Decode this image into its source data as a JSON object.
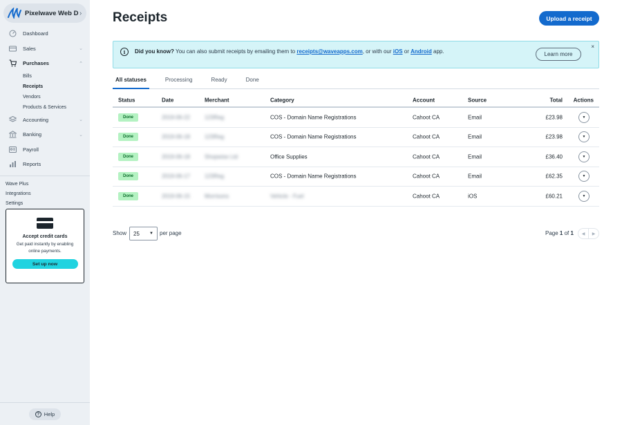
{
  "sidebar": {
    "business_name": "Pixelwave Web D...",
    "nav": [
      {
        "label": "Dashboard",
        "icon": "dashboard-icon"
      },
      {
        "label": "Sales",
        "icon": "sales-icon"
      },
      {
        "label": "Purchases",
        "icon": "cart-icon"
      }
    ],
    "purchases_sub": [
      "Bills",
      "Receipts",
      "Vendors",
      "Products & Services"
    ],
    "nav2": [
      {
        "label": "Accounting",
        "icon": "accounting-icon"
      },
      {
        "label": "Banking",
        "icon": "bank-icon"
      },
      {
        "label": "Payroll",
        "icon": "payroll-icon"
      },
      {
        "label": "Reports",
        "icon": "reports-icon"
      }
    ],
    "extras": [
      "Wave Plus",
      "Integrations",
      "Settings"
    ],
    "promo": {
      "title": "Accept credit cards",
      "text": "Get paid instantly by enabling online payments.",
      "button": "Set up now"
    },
    "help": "Help"
  },
  "page": {
    "title": "Receipts",
    "upload_button": "Upload a receipt"
  },
  "banner": {
    "strong": "Did you know?",
    "text1": " You can also submit receipts by emailing them to ",
    "email": "receipts@waveapps.com",
    "text2": ", or with our ",
    "ios": "iOS",
    "text3": " or ",
    "android": "Android",
    "text4": " app.",
    "learn_more": "Learn more",
    "close": "×"
  },
  "tabs": [
    "All statuses",
    "Processing",
    "Ready",
    "Done"
  ],
  "table": {
    "headers": {
      "status": "Status",
      "date": "Date",
      "merchant": "Merchant",
      "category": "Category",
      "account": "Account",
      "source": "Source",
      "total": "Total",
      "actions": "Actions"
    },
    "rows": [
      {
        "status": "Done",
        "date": "2019-06-22",
        "merchant": "123Reg",
        "category": "COS - Domain Name Registrations",
        "account": "Cahoot CA",
        "source": "Email",
        "total": "£23.98"
      },
      {
        "status": "Done",
        "date": "2019-06-18",
        "merchant": "123Reg",
        "category": "COS - Domain Name Registrations",
        "account": "Cahoot CA",
        "source": "Email",
        "total": "£23.98"
      },
      {
        "status": "Done",
        "date": "2019-06-18",
        "merchant": "Shopwise Ltd",
        "category": "Office Supplies",
        "account": "Cahoot CA",
        "source": "Email",
        "total": "£36.40"
      },
      {
        "status": "Done",
        "date": "2019-06-17",
        "merchant": "123Reg",
        "category": "COS - Domain Name Registrations",
        "account": "Cahoot CA",
        "source": "Email",
        "total": "£62.35"
      },
      {
        "status": "Done",
        "date": "2019-06-15",
        "merchant": "Morrisons",
        "category": "Vehicle - Fuel",
        "account": "Cahoot CA",
        "source": "iOS",
        "total": "£60.21"
      }
    ]
  },
  "pagination": {
    "show_label": "Show",
    "per_page_value": "25",
    "per_page_label": "per page",
    "page_word": "Page",
    "current": "1",
    "of_word": "of",
    "total": "1"
  }
}
